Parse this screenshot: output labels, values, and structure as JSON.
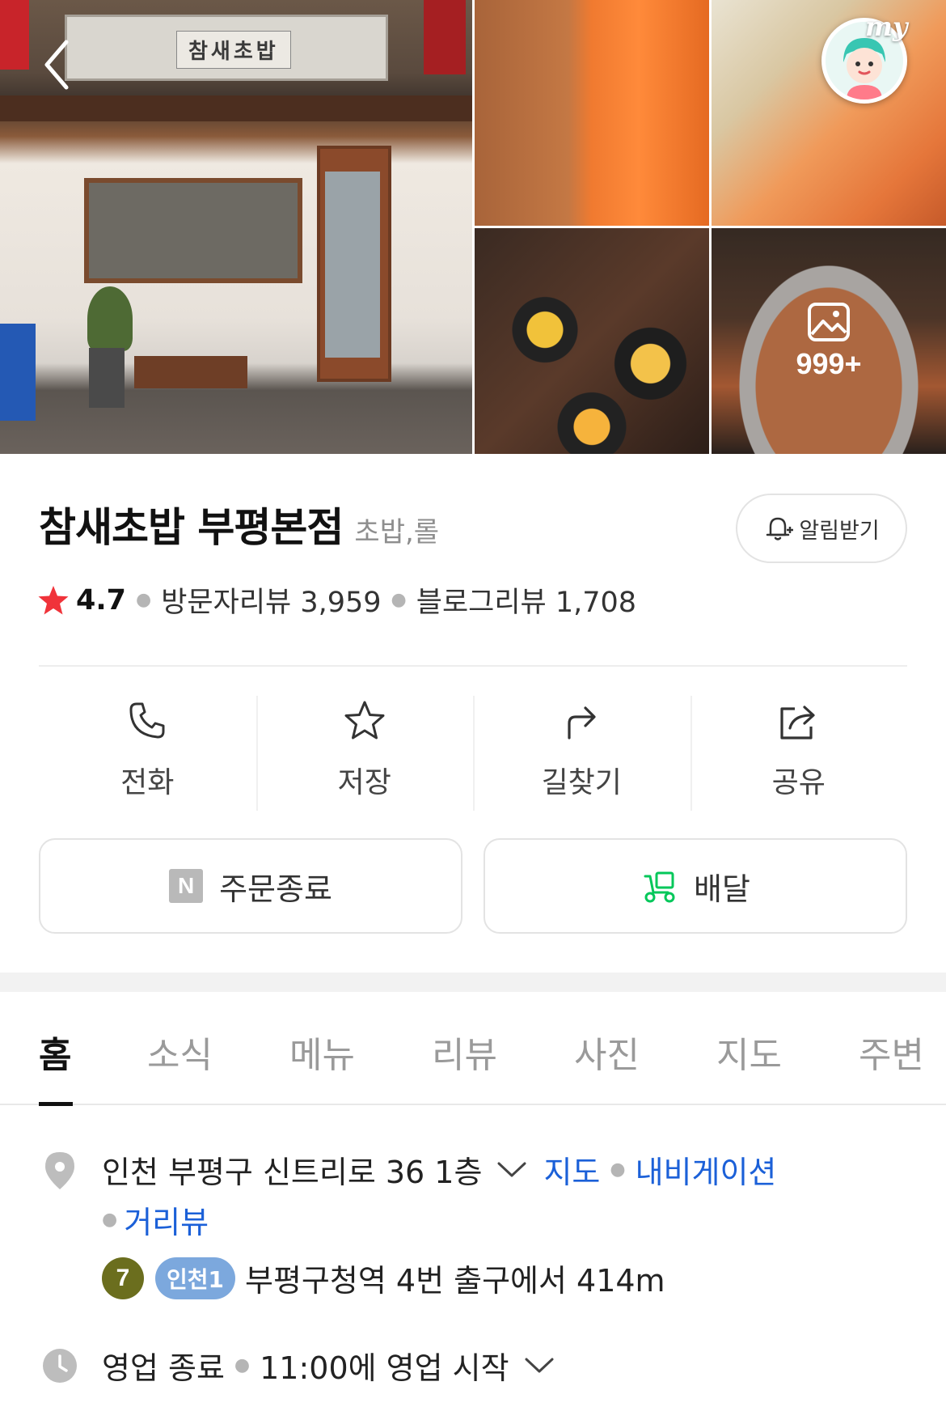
{
  "header": {
    "back_icon": "chevron-left-icon",
    "storefront_sign": "참새초밥",
    "my_label": "my",
    "more_photos_count": "999+"
  },
  "place": {
    "name": "참새초밥 부평본점",
    "category": "초밥,롤",
    "notify_label": "알림받기",
    "rating": "4.7",
    "visitor_reviews": "방문자리뷰 3,959",
    "blog_reviews": "블로그리뷰 1,708",
    "star_color": "#f0333a"
  },
  "actions": [
    {
      "label": "전화",
      "icon": "phone-icon"
    },
    {
      "label": "저장",
      "icon": "star-icon"
    },
    {
      "label": "길찾기",
      "icon": "directions-icon"
    },
    {
      "label": "공유",
      "icon": "share-icon"
    }
  ],
  "buttons": {
    "order_badge": "N",
    "order_label": "주문종료",
    "delivery_label": "배달",
    "delivery_icon_color": "#03c75a"
  },
  "tabs": [
    {
      "label": "홈",
      "active": true
    },
    {
      "label": "소식",
      "active": false
    },
    {
      "label": "메뉴",
      "active": false
    },
    {
      "label": "리뷰",
      "active": false
    },
    {
      "label": "사진",
      "active": false
    },
    {
      "label": "지도",
      "active": false
    },
    {
      "label": "주변",
      "active": false
    }
  ],
  "info": {
    "address": "인천 부평구 신트리로 36 1층",
    "map_link": "지도",
    "navigation_link": "내비게이션",
    "street_view_link": "거리뷰",
    "subway_line_number": "7",
    "subway_line_name": "인천1",
    "subway_text": "부평구청역 4번 출구에서 414m",
    "hours_status": "영업 종료",
    "hours_next": "11:00에 영업 시작",
    "link_color": "#1b60d8"
  }
}
